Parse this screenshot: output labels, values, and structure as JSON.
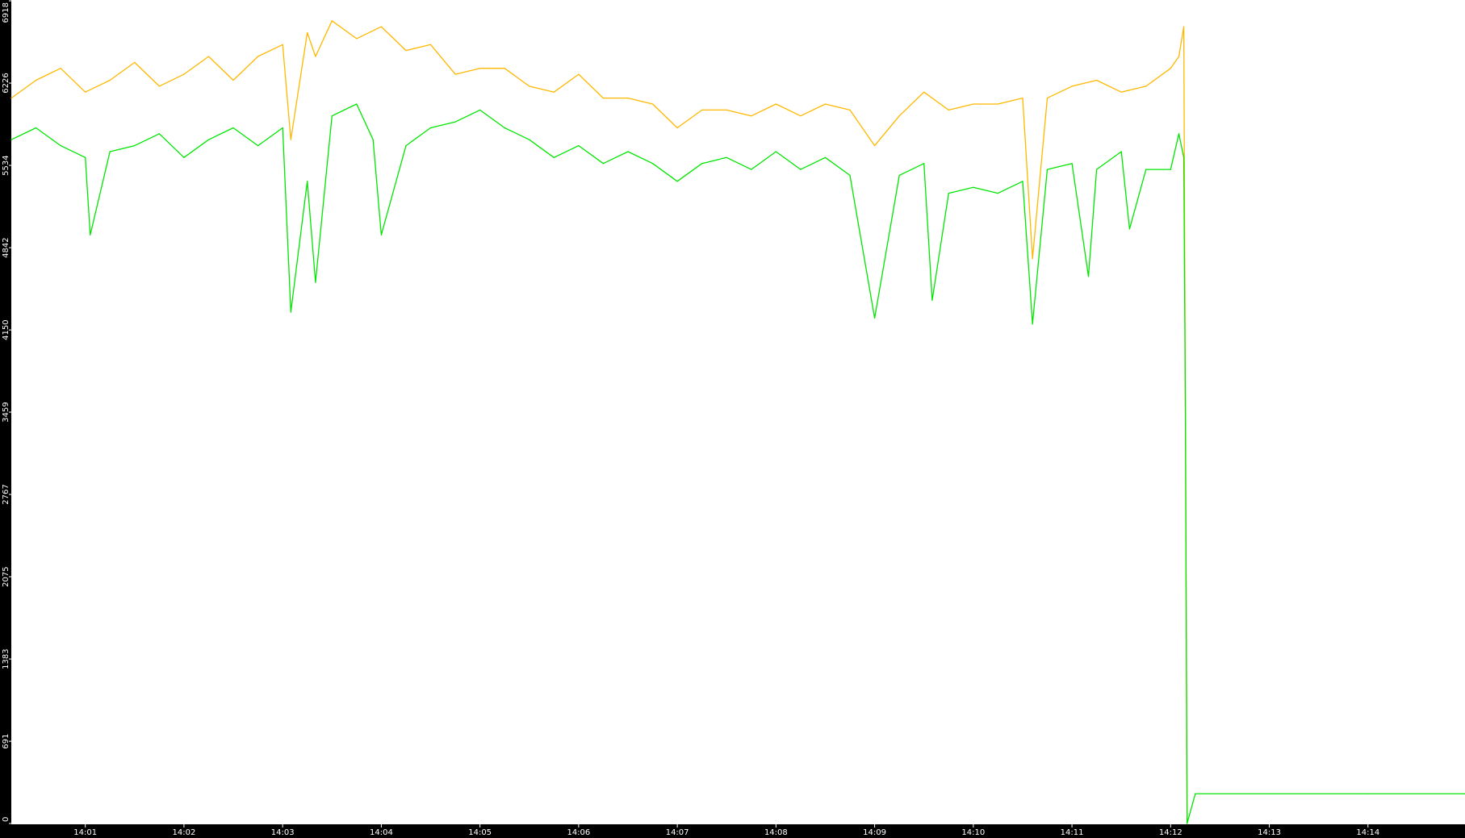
{
  "chart_data": {
    "type": "line",
    "title": "",
    "xlabel": "",
    "ylabel": "",
    "grid": false,
    "legend": "none",
    "background": "#ffffff",
    "axis_color": "#000000",
    "tick_label_color": "#ffffff",
    "xlim": [
      "14:00:15",
      "14:14:59"
    ],
    "ylim": [
      0,
      6918
    ],
    "y_ticks": [
      0,
      691,
      1383,
      2075,
      2767,
      3459,
      4150,
      4842,
      5534,
      6226,
      6918
    ],
    "y_tick_labels": [
      "0",
      "691",
      "1383",
      "2075",
      "2767",
      "3459",
      "4150",
      "4842",
      "5534",
      "6226",
      "6918"
    ],
    "x_ticks": [
      "14:01",
      "14:02",
      "14:03",
      "14:04",
      "14:05",
      "14:06",
      "14:07",
      "14:08",
      "14:09",
      "14:10",
      "14:11",
      "14:12",
      "14:13",
      "14:14"
    ],
    "series": [
      {
        "color": "#ffb800",
        "x": [
          "14:00:15",
          "14:00:30",
          "14:00:45",
          "14:01:00",
          "14:01:15",
          "14:01:30",
          "14:01:45",
          "14:02:00",
          "14:02:15",
          "14:02:30",
          "14:02:45",
          "14:03:00",
          "14:03:05",
          "14:03:15",
          "14:03:20",
          "14:03:30",
          "14:03:45",
          "14:04:00",
          "14:04:15",
          "14:04:30",
          "14:04:45",
          "14:05:00",
          "14:05:15",
          "14:05:30",
          "14:05:45",
          "14:06:00",
          "14:06:15",
          "14:06:30",
          "14:06:45",
          "14:07:00",
          "14:07:15",
          "14:07:30",
          "14:07:45",
          "14:08:00",
          "14:08:15",
          "14:08:30",
          "14:08:45",
          "14:09:00",
          "14:09:15",
          "14:09:30",
          "14:09:45",
          "14:10:00",
          "14:10:15",
          "14:10:30",
          "14:10:36",
          "14:10:45",
          "14:11:00",
          "14:11:15",
          "14:11:30",
          "14:11:45",
          "14:12:00",
          "14:12:05",
          "14:12:08",
          "14:12:09",
          "14:12:10"
        ],
        "values": [
          6100,
          6250,
          6350,
          6150,
          6250,
          6400,
          6200,
          6300,
          6450,
          6250,
          6450,
          6550,
          5750,
          6650,
          6450,
          6750,
          6600,
          6700,
          6500,
          6550,
          6300,
          6350,
          6350,
          6200,
          6150,
          6300,
          6100,
          6100,
          6050,
          5850,
          6000,
          6000,
          5950,
          6050,
          5950,
          6050,
          6000,
          5700,
          5950,
          6150,
          6000,
          6050,
          6050,
          6100,
          4750,
          6100,
          6200,
          6250,
          6150,
          6200,
          6350,
          6450,
          6700,
          3200,
          0
        ]
      },
      {
        "color": "#00e600",
        "x": [
          "14:00:15",
          "14:00:30",
          "14:00:45",
          "14:01:00",
          "14:01:03",
          "14:01:15",
          "14:01:30",
          "14:01:45",
          "14:02:00",
          "14:02:15",
          "14:02:30",
          "14:02:45",
          "14:03:00",
          "14:03:05",
          "14:03:15",
          "14:03:20",
          "14:03:30",
          "14:03:45",
          "14:03:55",
          "14:04:00",
          "14:04:15",
          "14:04:30",
          "14:04:45",
          "14:05:00",
          "14:05:15",
          "14:05:30",
          "14:05:45",
          "14:06:00",
          "14:06:15",
          "14:06:30",
          "14:06:45",
          "14:07:00",
          "14:07:15",
          "14:07:30",
          "14:07:45",
          "14:08:00",
          "14:08:15",
          "14:08:30",
          "14:08:45",
          "14:09:00",
          "14:09:15",
          "14:09:30",
          "14:09:35",
          "14:09:45",
          "14:10:00",
          "14:10:15",
          "14:10:30",
          "14:10:36",
          "14:10:45",
          "14:11:00",
          "14:11:10",
          "14:11:15",
          "14:11:30",
          "14:11:35",
          "14:11:45",
          "14:12:00",
          "14:12:05",
          "14:12:08",
          "14:12:09",
          "14:12:10",
          "14:12:15",
          "14:13:00",
          "14:14:00",
          "14:14:59"
        ],
        "values": [
          5750,
          5850,
          5700,
          5600,
          4950,
          5650,
          5700,
          5800,
          5600,
          5750,
          5850,
          5700,
          5850,
          4300,
          5400,
          4550,
          5950,
          6050,
          5750,
          4950,
          5700,
          5850,
          5900,
          6000,
          5850,
          5750,
          5600,
          5700,
          5550,
          5650,
          5550,
          5400,
          5550,
          5600,
          5500,
          5650,
          5500,
          5600,
          5450,
          4250,
          5450,
          5550,
          4400,
          5300,
          5350,
          5300,
          5400,
          4200,
          5500,
          5550,
          4600,
          5500,
          5650,
          5000,
          5500,
          5500,
          5800,
          5600,
          3350,
          0,
          250,
          250,
          250,
          250
        ]
      }
    ]
  }
}
